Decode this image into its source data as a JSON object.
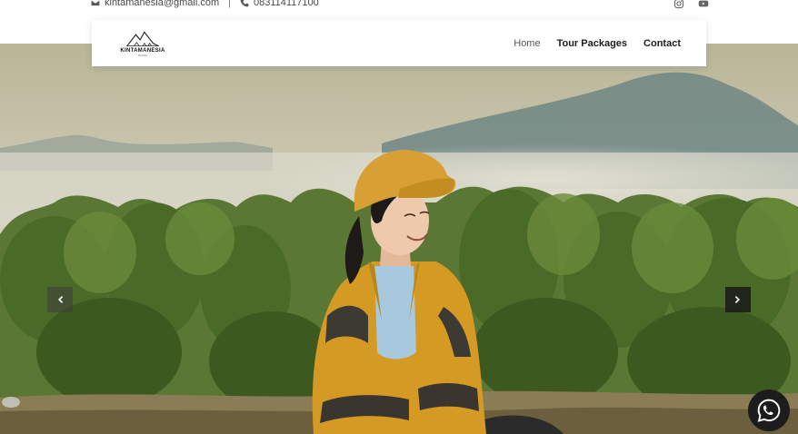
{
  "contact": {
    "email": "kintamanesia@gmail.com",
    "separator": "|",
    "phone": "083114117100"
  },
  "social": [
    "instagram-icon",
    "youtube-icon"
  ],
  "logo": {
    "name": "KINTAMANESIA",
    "tagline": "TRAVEL"
  },
  "nav": {
    "items": [
      {
        "label": "Home",
        "active": true
      },
      {
        "label": "Tour Packages",
        "active": false
      },
      {
        "label": "Contact",
        "active": false
      }
    ]
  },
  "carousel": {
    "prev_icon": "chevron-left-icon",
    "next_icon": "chevron-right-icon"
  },
  "whatsapp": {
    "icon": "whatsapp-icon"
  },
  "colors": {
    "accent": "#1c1c1c",
    "jacket": "#d9a12a",
    "forest": "#48662c"
  }
}
